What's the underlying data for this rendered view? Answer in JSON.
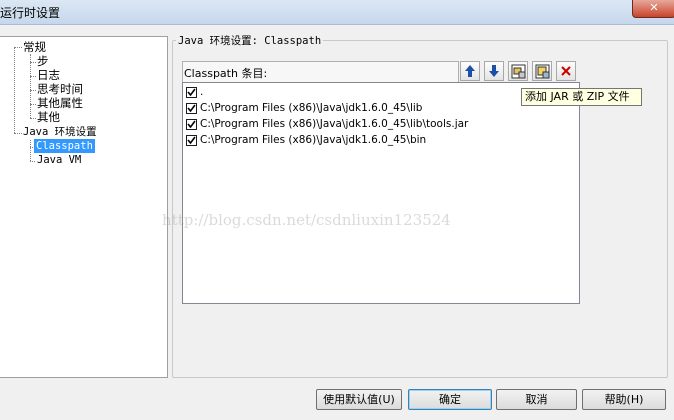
{
  "window": {
    "title": "运行时设置",
    "close_glyph": "✕"
  },
  "tree": {
    "root_general": "常规",
    "general_children": [
      "步",
      "日志",
      "思考时间",
      "其他属性",
      "其他"
    ],
    "root_java": "Java 环境设置",
    "java_children": [
      "Classpath",
      "Java VM"
    ],
    "selected": "Classpath"
  },
  "group": {
    "title": "Java 环境设置: Classpath"
  },
  "classpath": {
    "header": "Classpath 条目:",
    "toolbar": [
      {
        "icon": "arrow-up-icon",
        "tooltip": ""
      },
      {
        "icon": "arrow-down-icon",
        "tooltip": ""
      },
      {
        "icon": "add-jar-icon",
        "tooltip": ""
      },
      {
        "icon": "add-folder-icon",
        "tooltip": ""
      },
      {
        "icon": "delete-icon",
        "tooltip": ""
      }
    ],
    "entries": [
      {
        "checked": true,
        "path": "."
      },
      {
        "checked": true,
        "path": "C:\\Program Files (x86)\\Java\\jdk1.6.0_45\\lib"
      },
      {
        "checked": true,
        "path": "C:\\Program Files (x86)\\Java\\jdk1.6.0_45\\lib\\tools.jar"
      },
      {
        "checked": true,
        "path": "C:\\Program Files (x86)\\Java\\jdk1.6.0_45\\bin"
      }
    ],
    "tooltip_text": "添加 JAR 或 ZIP 文件"
  },
  "watermark": "http://blog.csdn.net/csdnliuxin123524",
  "buttons": {
    "use_defaults": "使用默认值(U)",
    "ok": "确定",
    "cancel": "取消",
    "help": "帮助(H)"
  },
  "colors": {
    "selection": "#3399ff",
    "tooltip_bg": "#ffffe1",
    "delete": "#cc0000",
    "arrow": "#1c4fa6"
  }
}
